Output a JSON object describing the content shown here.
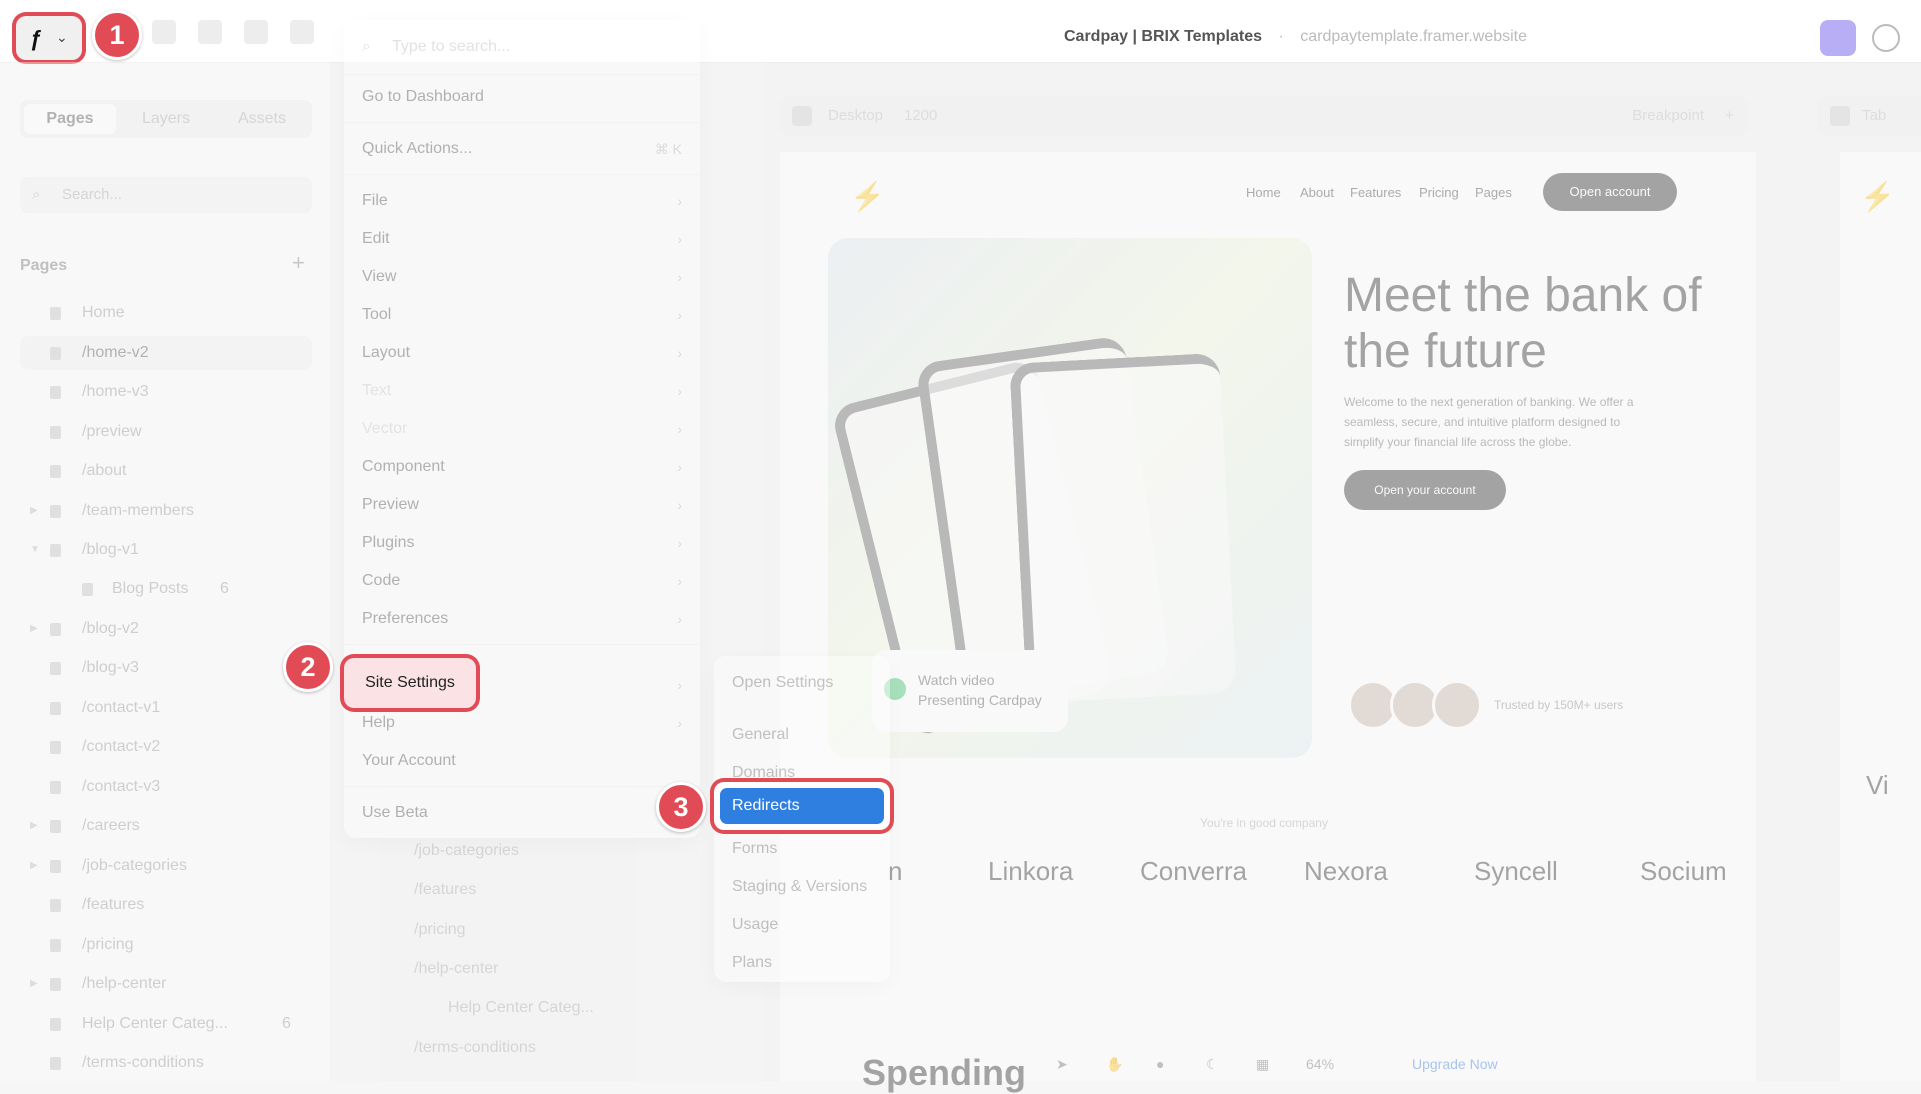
{
  "topbar": {
    "doc_title": "Cardpay | BRIX Templates",
    "doc_separator": "·",
    "doc_url": "cardpaytemplate.framer.website"
  },
  "steps": [
    "1",
    "2",
    "3"
  ],
  "sidebar": {
    "tabs": [
      "Pages",
      "Layers",
      "Assets"
    ],
    "search_placeholder": "Search...",
    "pages_heading": "Pages",
    "pages": [
      {
        "label": "Home"
      },
      {
        "label": "/home-v2"
      },
      {
        "label": "/home-v3"
      },
      {
        "label": "/preview"
      },
      {
        "label": "/about"
      },
      {
        "label": "/team-members"
      },
      {
        "label": "/blog-v1"
      },
      {
        "label": "Blog Posts",
        "count": "6"
      },
      {
        "label": "/blog-v2"
      },
      {
        "label": "/blog-v3"
      },
      {
        "label": "/contact-v1"
      },
      {
        "label": "/contact-v2"
      },
      {
        "label": "/contact-v3"
      },
      {
        "label": "/careers"
      },
      {
        "label": "/job-categories"
      },
      {
        "label": "/features"
      },
      {
        "label": "/pricing"
      },
      {
        "label": "/help-center"
      },
      {
        "label": "Help Center Categ...",
        "count": "6"
      },
      {
        "label": "/terms-conditions"
      }
    ]
  },
  "menu": {
    "search_placeholder": "Type to search...",
    "go_dashboard": "Go to Dashboard",
    "quick_actions": "Quick Actions...",
    "quick_shortcut": "⌘ K",
    "items": [
      "File",
      "Edit",
      "View",
      "Tool",
      "Layout",
      "Text",
      "Vector",
      "Component",
      "Preview",
      "Plugins",
      "Code",
      "Preferences"
    ],
    "site_settings": "Site Settings",
    "help": "Help",
    "your_account": "Your Account",
    "use_beta": "Use Beta"
  },
  "submenu": {
    "open_settings": "Open Settings",
    "items": [
      "General",
      "Domains",
      "Redirects",
      "Forms",
      "Staging & Versions",
      "Usage",
      "Plans"
    ]
  },
  "ghost_tree": [
    "/job-categories",
    "/features",
    "/pricing",
    "/help-center",
    "Help Center Categ...",
    "/terms-conditions"
  ],
  "canvas": {
    "frame_label": "Desktop",
    "frame_width": "1200",
    "breakpoint": "Breakpoint",
    "next_frame_label": "Tab",
    "site_nav": [
      "Home",
      "About",
      "Features",
      "Pricing",
      "Pages"
    ],
    "open_account": "Open account",
    "hero_title": "Meet the bank of the future",
    "hero_sub": "Welcome to the next generation of banking. We offer a seamless, secure, and intuitive platform designed to simplify your financial life across the globe.",
    "hero_cta": "Open your account",
    "watch_video": "Watch video",
    "presenting": "Presenting Cardpay",
    "trusted": "Trusted by 150M+ users",
    "good_company": "You're in good company",
    "partners": [
      "Linkora",
      "Converra",
      "Nexora",
      "Syncell",
      "Socium"
    ],
    "partner_partial_left": "n",
    "partner_partial_right": "Vi",
    "spending_partial": "Spending",
    "zoom": "64%",
    "upgrade": "Upgrade Now"
  },
  "colors": {
    "highlight": "#e14b55",
    "selected_item": "#2f7fe0"
  }
}
